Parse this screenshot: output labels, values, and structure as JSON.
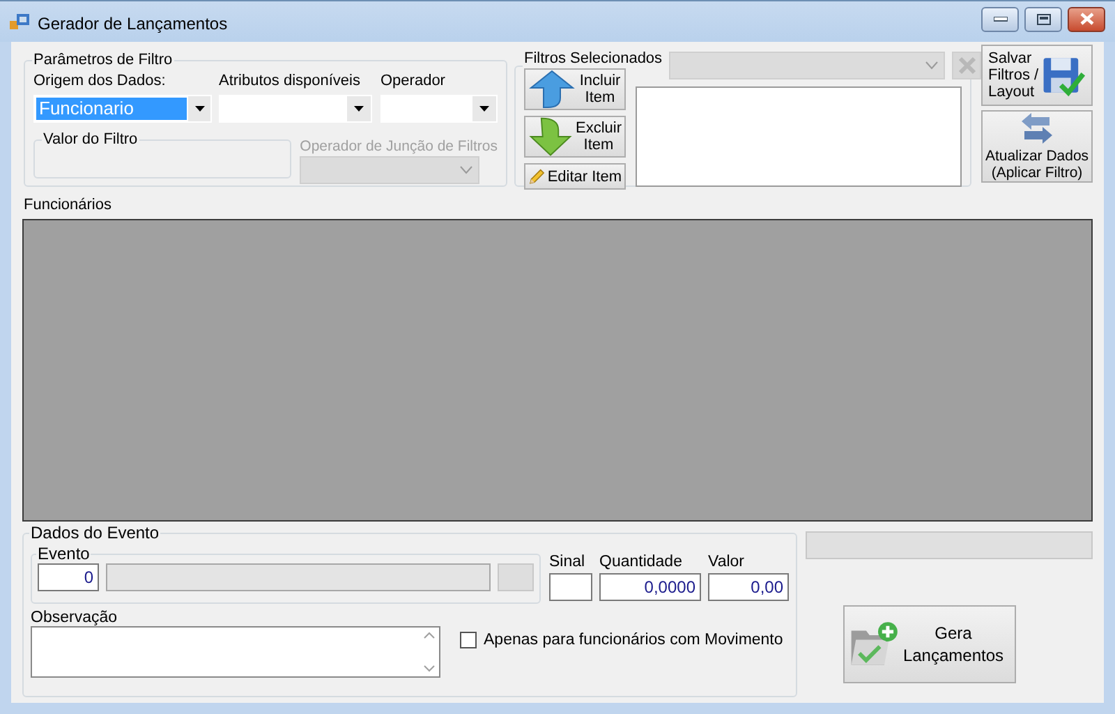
{
  "window": {
    "title": "Gerador de Lançamentos"
  },
  "filter_params": {
    "title": "Parâmetros de Filtro",
    "fields": [
      {
        "label": "Origem dos Dados:",
        "value": "Funcionario",
        "selected": true
      },
      {
        "label": "Atributos disponíveis"
      },
      {
        "label": "Operador"
      }
    ],
    "filter_value": {
      "title": "Valor do Filtro"
    },
    "join_operator": {
      "label": "Operador de Junção de Filtros",
      "disabled": true
    }
  },
  "selected_filters": {
    "title": "Filtros Selecionados",
    "combo_disabled": true,
    "clear_disabled": true,
    "buttons": [
      {
        "kind": "add",
        "lines": [
          "Incluir",
          "Item"
        ]
      },
      {
        "kind": "remove",
        "lines": [
          "Excluir",
          "Item"
        ]
      },
      {
        "kind": "edit",
        "lines": [
          "Editar Item"
        ]
      }
    ]
  },
  "side_buttons": [
    {
      "kind": "save",
      "lines": [
        "Salvar",
        "Filtros /",
        "Layout"
      ]
    },
    {
      "kind": "refresh",
      "lines": [
        "Atualizar Dados",
        "(Aplicar Filtro)"
      ]
    }
  ],
  "employees": {
    "title": "Funcionários"
  },
  "event_data": {
    "title": "Dados do Evento",
    "event": {
      "title": "Evento",
      "code": "0"
    },
    "sign": {
      "label": "Sinal"
    },
    "quantity": {
      "label": "Quantidade",
      "value": "0,0000"
    },
    "amount": {
      "label": "Valor",
      "value": "0,00"
    },
    "note": {
      "label": "Observação"
    },
    "only_with_movement": {
      "label": "Apenas para funcionários com Movimento",
      "checked": false
    }
  },
  "generate_button": {
    "lines": [
      "Gera",
      "Lançamentos"
    ]
  }
}
